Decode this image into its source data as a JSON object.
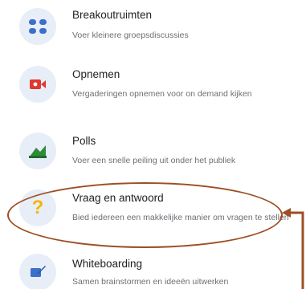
{
  "features": [
    {
      "title": "Breakoutruimten",
      "description": "Voer kleinere groepsdiscussies",
      "icon": "breakout-rooms-icon"
    },
    {
      "title": "Opnemen",
      "description": "Vergaderingen opnemen voor on demand kijken",
      "icon": "record-video-icon"
    },
    {
      "title": "Polls",
      "description": "Voer een snelle peiling uit onder het publiek",
      "icon": "poll-icon"
    },
    {
      "title": "Vraag en antwoord",
      "description": "Bied iedereen een makkelijke manier om vragen te stellen",
      "icon": "question-mark-icon"
    },
    {
      "title": "Whiteboarding",
      "description": "Samen brainstormen en ideeën uitwerken",
      "icon": "whiteboard-icon"
    }
  ],
  "colors": {
    "icon_background": "#e8eef8",
    "annotation": "#9c4f23",
    "breakout_blue": "#3b6fc9",
    "record_red": "#e0392f",
    "poll_green": "#2e8b3a",
    "qa_yellow": "#f2b705",
    "whiteboard_blue": "#3b6fc9"
  }
}
